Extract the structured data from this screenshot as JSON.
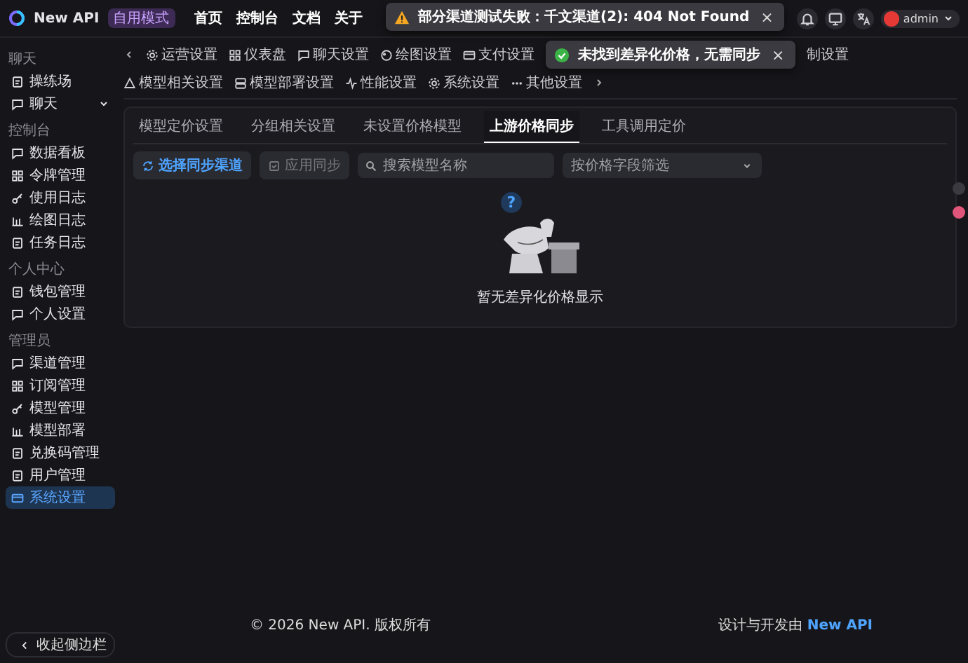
{
  "header": {
    "logo_text": "New API",
    "badge": "自用模式",
    "nav": [
      "首页",
      "控制台",
      "文档",
      "关于"
    ],
    "user": {
      "name": "admin"
    }
  },
  "toasts": [
    {
      "kind": "warning",
      "text": "部分渠道测试失败：千文渠道(2): 404 Not Found",
      "close": "×"
    },
    {
      "kind": "success",
      "text": "未找到差异化价格，无需同步",
      "close": "×"
    }
  ],
  "sidebar": {
    "sections": [
      {
        "title": "聊天",
        "items": [
          {
            "label": "操练场",
            "selected": false
          },
          {
            "label": "聊天",
            "selected": false,
            "expanded": false
          }
        ]
      },
      {
        "title": "控制台",
        "items": [
          {
            "label": "数据看板",
            "selected": false
          },
          {
            "label": "令牌管理",
            "selected": false
          },
          {
            "label": "使用日志",
            "selected": false
          },
          {
            "label": "绘图日志",
            "selected": false
          },
          {
            "label": "任务日志",
            "selected": false
          }
        ]
      },
      {
        "title": "个人中心",
        "items": [
          {
            "label": "钱包管理",
            "selected": false
          },
          {
            "label": "个人设置",
            "selected": false
          }
        ]
      },
      {
        "title": "管理员",
        "items": [
          {
            "label": "渠道管理",
            "selected": false
          },
          {
            "label": "订阅管理",
            "selected": false
          },
          {
            "label": "模型管理",
            "selected": false
          },
          {
            "label": "模型部署",
            "selected": false
          },
          {
            "label": "兑换码管理",
            "selected": false
          },
          {
            "label": "用户管理",
            "selected": false
          },
          {
            "label": "系统设置",
            "selected": true
          }
        ]
      }
    ],
    "collapse_button": "收起侧边栏"
  },
  "settings_tabs": {
    "before_toast": [
      "运营设置",
      "仪表盘",
      "聊天设置",
      "绘图设置",
      "支付设置"
    ],
    "after_toast": [
      "制设置",
      "模型相关设置",
      "模型部署设置",
      "性能设置",
      "系统设置",
      "其他设置"
    ]
  },
  "sub_tabs": [
    {
      "label": "模型定价设置",
      "selected": false
    },
    {
      "label": "分组相关设置",
      "selected": false
    },
    {
      "label": "未设置价格模型",
      "selected": false
    },
    {
      "label": "上游价格同步",
      "selected": true
    },
    {
      "label": "工具调用定价",
      "selected": false
    }
  ],
  "toolbar": {
    "buttons": [
      {
        "label": "选择同步渠道",
        "disabled": false
      },
      {
        "label": "应用同步",
        "disabled": true
      }
    ],
    "search": {
      "placeholder": "搜索模型名称"
    },
    "filter": {
      "placeholder": "按价格字段筛选"
    }
  },
  "empty_state": {
    "mark": "?",
    "text": "暂无差异化价格显示"
  },
  "footer": {
    "copyright": "© 2026 New API. 版权所有",
    "credit": "设计与开发由",
    "credit_link": "New API"
  }
}
